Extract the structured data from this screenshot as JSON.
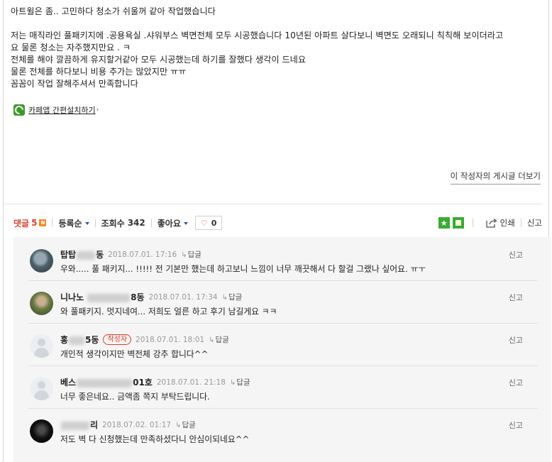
{
  "post": {
    "lines": [
      "아트윌은 좀.. 고민하다 청소가 쉬울꺼 같아 작업했습니다",
      "",
      "저는 매직라인 풀패키지에 .공용욕실 .샤워부스 벽면전체 모두 시공했습니다 10년된 아파트 살다보니 벽면도 오래되니 칙칙해 보이더라고",
      "요 물론 청소는 자주했지만요 . ㅋ",
      "전체를 해야 깔끔하게 유지할거같아 모두 시공했는데 하기를 잘했다 생각이 드네요",
      "물론 전체를 하다보니 비용 추가는 많았지만 ㅠㅠ",
      "꼼꼼이 작업 잘해주셔서 만족합니다"
    ]
  },
  "cafe_app": {
    "label": "카페앱 간편설치하기",
    "arrow": "›"
  },
  "more_posts": "이 작성자의 게시글 더보기",
  "stats": {
    "comment_label": "댓글",
    "comment_count": "5",
    "new_badge": "N",
    "sort_label": "등록순",
    "views_label": "조회수",
    "views_value": "342",
    "like_label": "좋아요",
    "like_count": "0",
    "print_label": "인쇄",
    "report_label": "신고"
  },
  "comments": [
    {
      "nick_prefix": "탑탑",
      "nick_suffix": "동",
      "badge": "",
      "date": "2018.07.01. 17:16",
      "reply": "답글",
      "text": "우와..... 풀 패키지... !!!!! 전 기본만 했는데 하고보니 느낌이 너무 깨끗해서 다 할걸 그랬나 싶어요. ㅠㅜ",
      "report": "신고"
    },
    {
      "nick_prefix": "니나노",
      "nick_suffix": "8동",
      "badge": "",
      "date": "2018.07.01. 17:34",
      "reply": "답글",
      "text": "와 풀패키지. 멋지네여... 저희도 얼른 하고 후기 남길게요 ㅋㅋ",
      "report": "신고"
    },
    {
      "nick_prefix": "홍",
      "nick_suffix": "5동",
      "badge": "작성자",
      "date": "2018.07.01. 18:01",
      "reply": "답글",
      "text": "개인적 생각이지만 벽전체 강추 합니다^^",
      "report": "신고"
    },
    {
      "nick_prefix": "베스",
      "nick_suffix": "01호",
      "badge": "",
      "date": "2018.07.01. 21:18",
      "reply": "답글",
      "text": "너무 좋은네요.. 금액좀 쪽지 부탁드립니다.",
      "report": "신고"
    },
    {
      "nick_prefix": "",
      "nick_suffix": "리",
      "badge": "",
      "date": "2018.07.02. 01:17",
      "reply": "답글",
      "text": "저도 벽 다 신청했는데 만족하셨다니 안심이되네요^^",
      "report": "신고"
    }
  ]
}
